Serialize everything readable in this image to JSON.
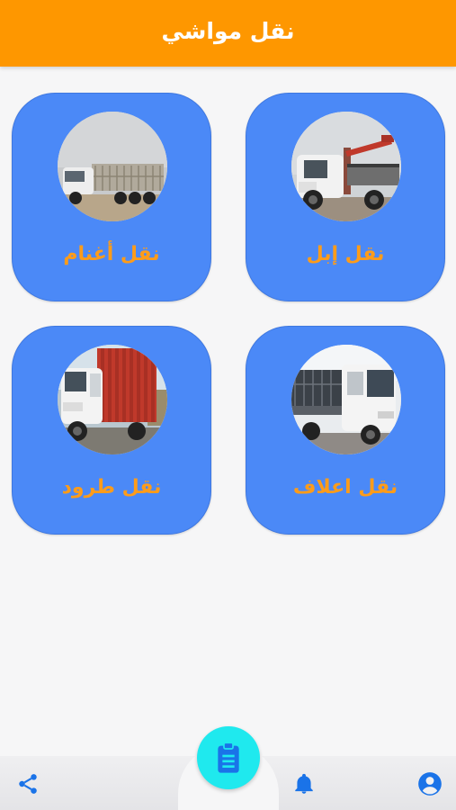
{
  "app_bar": {
    "title": "نقل مواشي"
  },
  "services": [
    {
      "label": "نقل إبل",
      "photo": "crane-truck-photo"
    },
    {
      "label": "نقل أغنام",
      "photo": "livestock-trailer-truck-photo"
    },
    {
      "label": "نقل اعلاف",
      "photo": "flatbed-truck-photo"
    },
    {
      "label": "نقل طرود",
      "photo": "box-truck-photo"
    }
  ],
  "bottom_nav": {
    "left_icon": "share-icon",
    "center_icon": "clipboard-icon",
    "right_icons": [
      "notification-bell-icon",
      "profile-icon"
    ]
  },
  "colors": {
    "app_bar": "#fe9700",
    "card": "#4b89f7",
    "card_label": "#fe9c1a",
    "fab": "#1fe9ee",
    "nav_icon": "#1a73e8"
  }
}
